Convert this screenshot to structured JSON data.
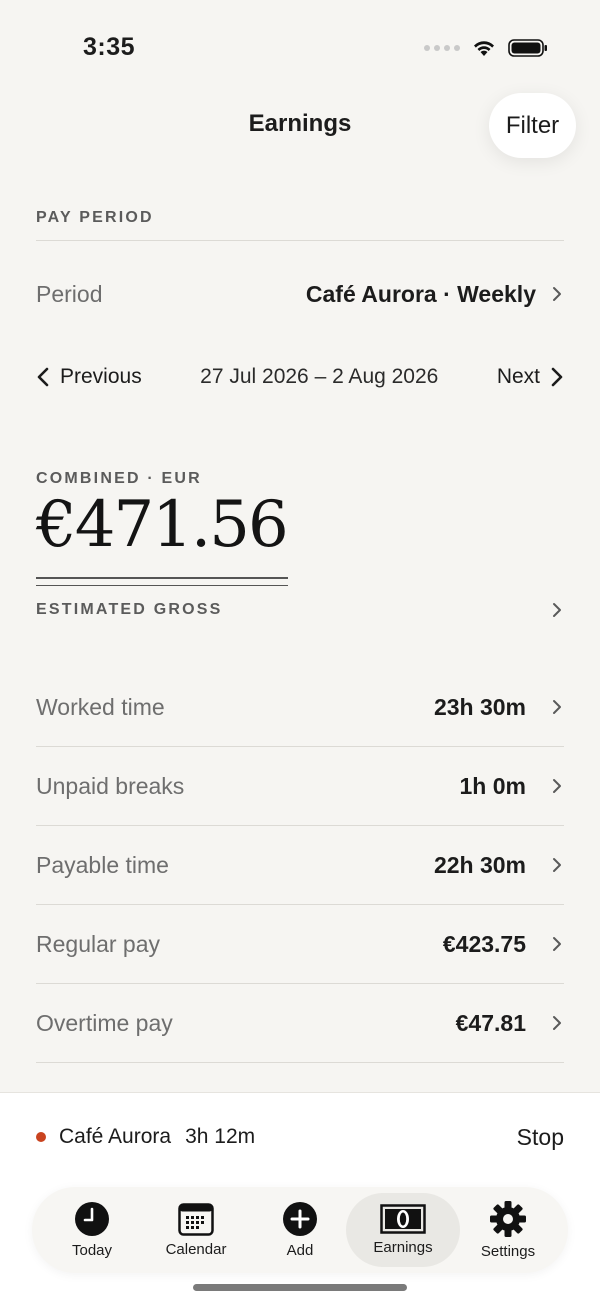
{
  "status": {
    "time": "3:35"
  },
  "header": {
    "title": "Earnings",
    "filter_label": "Filter"
  },
  "pay_period": {
    "section_label": "PAY PERIOD",
    "period_label": "Period",
    "period_value": "Café Aurora · Weekly",
    "prev_label": "Previous",
    "next_label": "Next",
    "date_range": "27 Jul 2026 – 2 Aug 2026"
  },
  "summary": {
    "combined_label": "COMBINED · EUR",
    "amount": "€471.56",
    "estimate_label": "ESTIMATED GROSS"
  },
  "stats": [
    {
      "label": "Worked time",
      "value": "23h 30m"
    },
    {
      "label": "Unpaid breaks",
      "value": "1h 0m"
    },
    {
      "label": "Payable time",
      "value": "22h 30m"
    },
    {
      "label": "Regular pay",
      "value": "€423.75"
    },
    {
      "label": "Overtime pay",
      "value": "€47.81"
    }
  ],
  "active_shift": {
    "name": "Café Aurora",
    "duration": "3h 12m",
    "stop_label": "Stop",
    "status_color": "#c9431f"
  },
  "tabs": [
    {
      "label": "Today",
      "icon": "clock-icon"
    },
    {
      "label": "Calendar",
      "icon": "calendar-icon"
    },
    {
      "label": "Add",
      "icon": "plus-circle-icon"
    },
    {
      "label": "Earnings",
      "icon": "banknote-icon",
      "active": true
    },
    {
      "label": "Settings",
      "icon": "gear-icon"
    }
  ]
}
